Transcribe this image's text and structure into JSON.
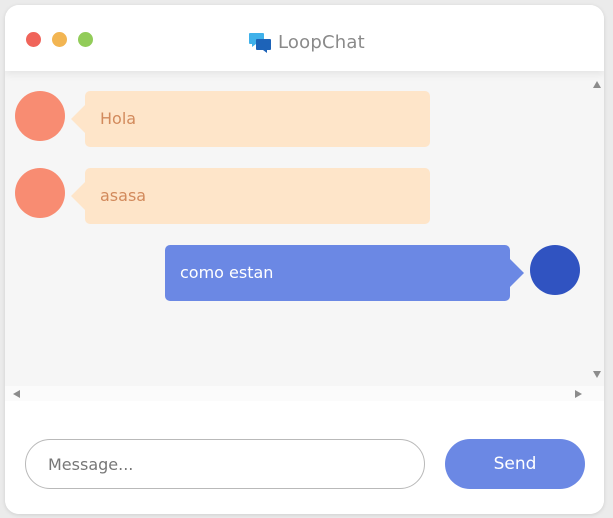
{
  "app": {
    "title": "LoopChat"
  },
  "colors": {
    "other_bubble": "#fee5c9",
    "other_text": "#d28a5c",
    "other_avatar": "#f88c72",
    "me_bubble": "#6b88e4",
    "me_avatar": "#3053c1",
    "send_button": "#6b88e4"
  },
  "messages": [
    {
      "sender": "other",
      "text": "Hola"
    },
    {
      "sender": "other",
      "text": "asasa"
    },
    {
      "sender": "me",
      "text": "como estan"
    }
  ],
  "composer": {
    "placeholder": "Message...",
    "value": "",
    "send_label": "Send"
  },
  "icons": {
    "logo": "chat-bubbles-icon",
    "scroll_up": "arrow-up-icon",
    "scroll_down": "arrow-down-icon",
    "scroll_left": "arrow-left-icon",
    "scroll_right": "arrow-right-icon"
  }
}
